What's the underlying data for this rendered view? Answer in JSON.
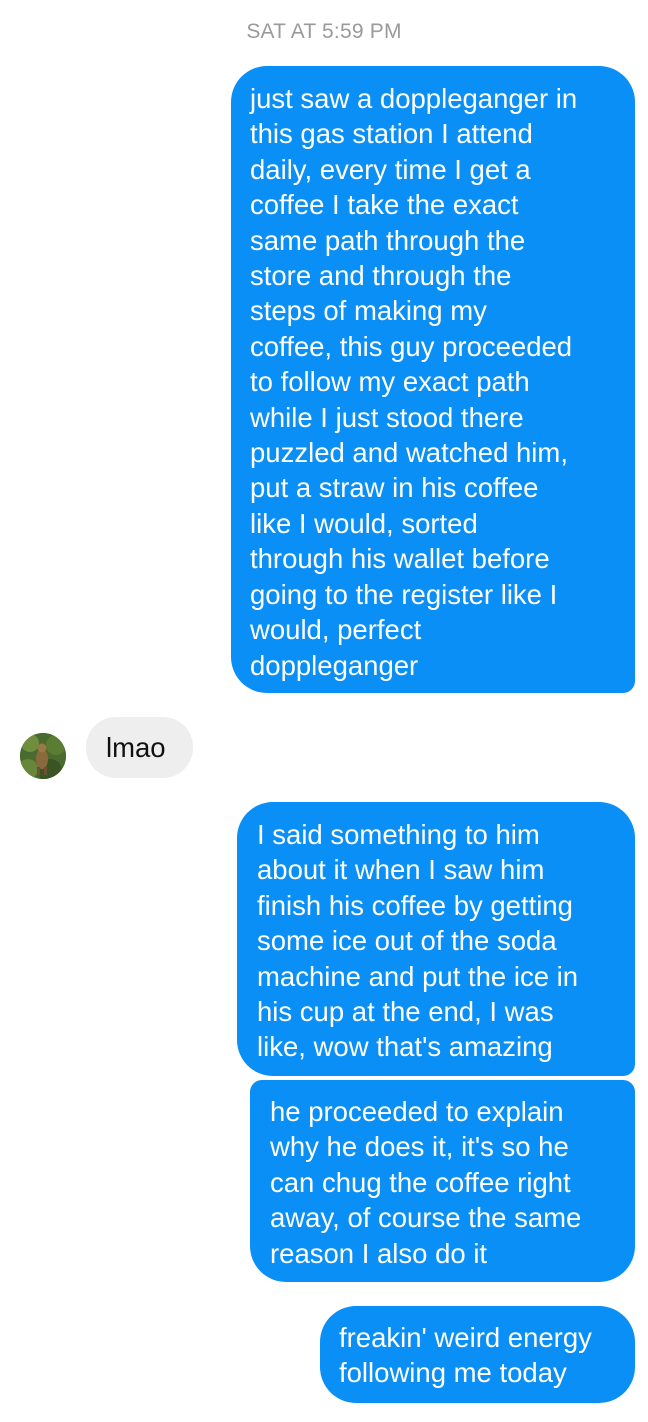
{
  "timestamp": "SAT AT 5:59 PM",
  "messages": [
    {
      "direction": "outgoing",
      "text": "just saw a doppleganger in\nthis gas station I attend\ndaily, every time I get a\ncoffee I take the exact\nsame path through the\nstore and through the\nsteps of making my\ncoffee, this guy proceeded\nto follow my exact path\nwhile I just stood there\npuzzled and watched him,\nput a straw in his coffee\nlike I would, sorted\nthrough his wallet before\ngoing to the register like I\nwould, perfect\ndoppleganger"
    },
    {
      "direction": "incoming",
      "text": "lmao"
    },
    {
      "direction": "outgoing",
      "text": "I said something to him\nabout it when I saw him\nfinish his coffee by getting\nsome ice out of the soda\nmachine and put the ice in\nhis cup at the end, I was\nlike, wow that's amazing"
    },
    {
      "direction": "outgoing",
      "text": "he proceeded to explain\nwhy he does it, it's so he\ncan chug the coffee right\naway, of course the same\nreason I also do it"
    },
    {
      "direction": "outgoing",
      "text": "freakin' weird energy\nfollowing me today"
    }
  ],
  "colors": {
    "outgoing_bubble": "#0a8ff6",
    "incoming_bubble": "#eeeeee",
    "timestamp_text": "#9a9a9a"
  },
  "icons": {
    "contact_avatar": "avatar-photo"
  }
}
